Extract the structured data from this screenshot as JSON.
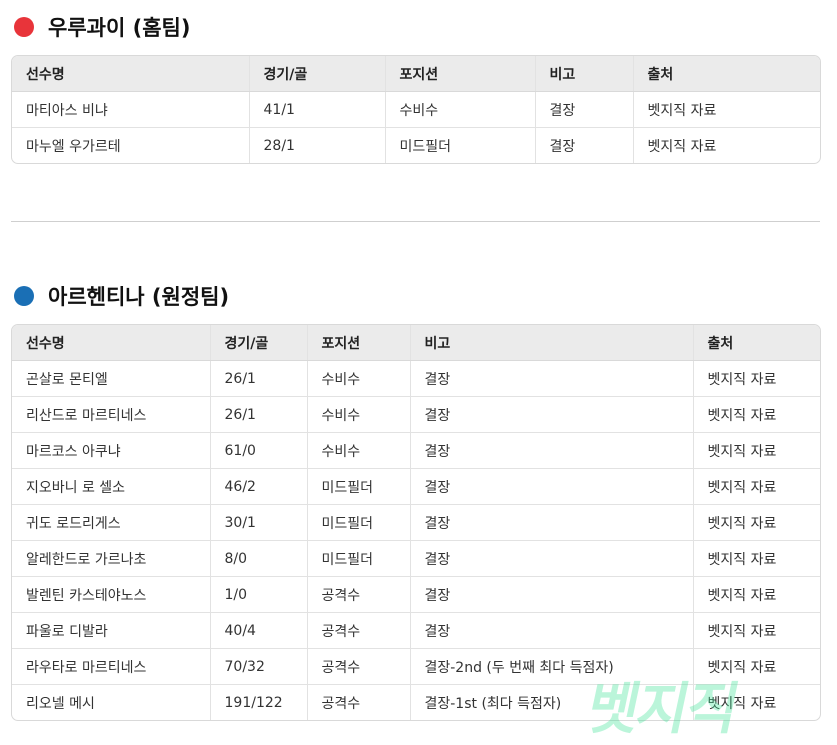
{
  "home": {
    "title": "우루과이 (홈팀)",
    "dot_color": "#e8343a",
    "headers": [
      "선수명",
      "경기/골",
      "포지션",
      "비고",
      "출처"
    ],
    "rows": [
      [
        "마티아스 비냐",
        "41/1",
        "수비수",
        "결장",
        "벳지직 자료"
      ],
      [
        "마누엘 우가르테",
        "28/1",
        "미드필더",
        "결장",
        "벳지직 자료"
      ]
    ]
  },
  "away": {
    "title": "아르헨티나 (원정팀)",
    "dot_color": "#1a6fb5",
    "headers": [
      "선수명",
      "경기/골",
      "포지션",
      "비고",
      "출처"
    ],
    "rows": [
      [
        "곤살로 몬티엘",
        "26/1",
        "수비수",
        "결장",
        "벳지직 자료"
      ],
      [
        "리산드로 마르티네스",
        "26/1",
        "수비수",
        "결장",
        "벳지직 자료"
      ],
      [
        "마르코스 아쿠냐",
        "61/0",
        "수비수",
        "결장",
        "벳지직 자료"
      ],
      [
        "지오바니 로 셀소",
        "46/2",
        "미드필더",
        "결장",
        "벳지직 자료"
      ],
      [
        "귀도 로드리게스",
        "30/1",
        "미드필더",
        "결장",
        "벳지직 자료"
      ],
      [
        "알레한드로 가르나초",
        "8/0",
        "미드필더",
        "결장",
        "벳지직 자료"
      ],
      [
        "발렌틴 카스테야노스",
        "1/0",
        "공격수",
        "결장",
        "벳지직 자료"
      ],
      [
        "파울로 디발라",
        "40/4",
        "공격수",
        "결장",
        "벳지직 자료"
      ],
      [
        "라우타로 마르티네스",
        "70/32",
        "공격수",
        "결장-2nd (두 번째 최다 득점자)",
        "벳지직 자료"
      ],
      [
        "리오넬 메시",
        "191/122",
        "공격수",
        "결장-1st (최다 득점자)",
        "벳지직 자료"
      ]
    ]
  },
  "watermark": "벳지직"
}
